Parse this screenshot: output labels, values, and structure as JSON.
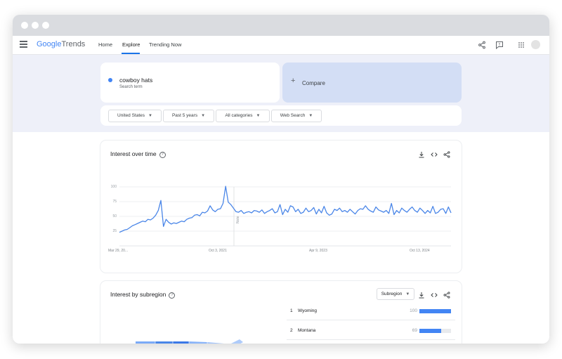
{
  "brand": {
    "google": "Google",
    "trends": "Trends"
  },
  "nav": {
    "home": "Home",
    "explore": "Explore",
    "trending": "Trending Now"
  },
  "search": {
    "term": "cowboy hats",
    "subtitle": "Search term",
    "compare": "Compare",
    "dot_color": "#4285f4"
  },
  "filters": {
    "region": "United States",
    "time": "Past 5 years",
    "category": "All categories",
    "type": "Web Search"
  },
  "interest_over_time": {
    "title": "Interest over time",
    "note_label": "Note"
  },
  "interest_by_subregion": {
    "title": "Interest by subregion",
    "dropdown": "Subregion"
  },
  "regions": [
    {
      "rank": "1",
      "name": "Wyoming",
      "value": "100",
      "fraction": 1.0
    },
    {
      "rank": "2",
      "name": "Montana",
      "value": "69",
      "fraction": 0.69
    }
  ],
  "icons": [
    "menu-icon",
    "share-icon",
    "feedback-icon",
    "apps-icon",
    "download-icon",
    "embed-icon",
    "help-icon",
    "add-icon"
  ],
  "colors": {
    "accent": "#1a73e8",
    "series": "#4a86e8",
    "compare_bg": "#d3def5"
  },
  "chart_data": {
    "type": "line",
    "title": "",
    "xlabel": "",
    "ylabel": "",
    "x_ticks": [
      "Mar 29, 20...",
      "Oct 3, 2021",
      "Apr 9, 2023",
      "Oct 13, 2024"
    ],
    "y_ticks": [
      "100",
      "75",
      "50",
      "25"
    ],
    "ylim": [
      0,
      100
    ],
    "grid": true,
    "series": [
      {
        "values": [
          23,
          25,
          27,
          28,
          31,
          34,
          36,
          38,
          40,
          42,
          41,
          45,
          44,
          47,
          52,
          60,
          77,
          33,
          45,
          40,
          37,
          39,
          38,
          40,
          42,
          41,
          45,
          47,
          48,
          52,
          53,
          51,
          57,
          56,
          59,
          68,
          61,
          58,
          62,
          63,
          72,
          101,
          74,
          70,
          64,
          58,
          57,
          60,
          55,
          57,
          58,
          56,
          60,
          59,
          57,
          61,
          55,
          58,
          60,
          63,
          56,
          58,
          70,
          53,
          62,
          57,
          68,
          66,
          58,
          62,
          55,
          57,
          64,
          58,
          60,
          65,
          54,
          62,
          56,
          67,
          56,
          52,
          54,
          62,
          60,
          64,
          58,
          60,
          57,
          62,
          58,
          54,
          60,
          63,
          62,
          68,
          62,
          59,
          57,
          66,
          61,
          59,
          57,
          60,
          55,
          72,
          53,
          60,
          56,
          64,
          60,
          57,
          62,
          66,
          60,
          57,
          64,
          60,
          55,
          60,
          56,
          67,
          55,
          57,
          62,
          63,
          55,
          66,
          56
        ]
      }
    ]
  }
}
